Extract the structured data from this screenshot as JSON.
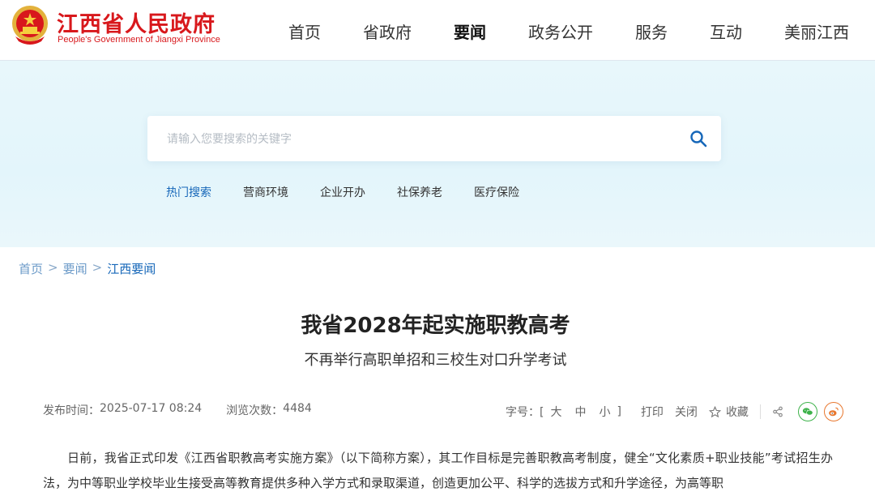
{
  "header": {
    "site_title": "江西省人民政府",
    "site_subtitle": "People's Government of Jiangxi Province",
    "nav": [
      "首页",
      "省政府",
      "要闻",
      "政务公开",
      "服务",
      "互动",
      "美丽江西"
    ],
    "active_nav": "要闻"
  },
  "search": {
    "placeholder": "请输入您要搜索的关键字",
    "value": "",
    "hot_label": "热门搜索",
    "hot_items": [
      "营商环境",
      "企业开办",
      "社保养老",
      "医疗保险"
    ]
  },
  "breadcrumb": [
    "首页",
    "要闻",
    "江西要闻"
  ],
  "article": {
    "title": "我省2028年起实施职教高考",
    "subtitle": "不再举行高职单招和三校生对口升学考试",
    "publish_label": "发布时间：",
    "publish_time": "2025-07-17 08:24",
    "views_label": "浏览次数：",
    "views": "4484",
    "font_size_label": "字号：[",
    "font_sizes": [
      "大",
      "中",
      "小"
    ],
    "font_size_close": "]",
    "print_label": "打印",
    "close_label": "关闭",
    "favorite_label": "收藏",
    "body": "日前，我省正式印发《江西省职教高考实施方案》（以下简称方案），其工作目标是完善职教高考制度，健全“文化素质+职业技能”考试招生办法，为中等职业学校毕业生接受高等教育提供多种入学方式和录取渠道，创造更加公平、科学的选拔方式和升学途径，为高等职"
  },
  "colors": {
    "brand_red": "#d8181c",
    "link_blue": "#1667b9",
    "hero_bg": "#e3f5fb"
  }
}
